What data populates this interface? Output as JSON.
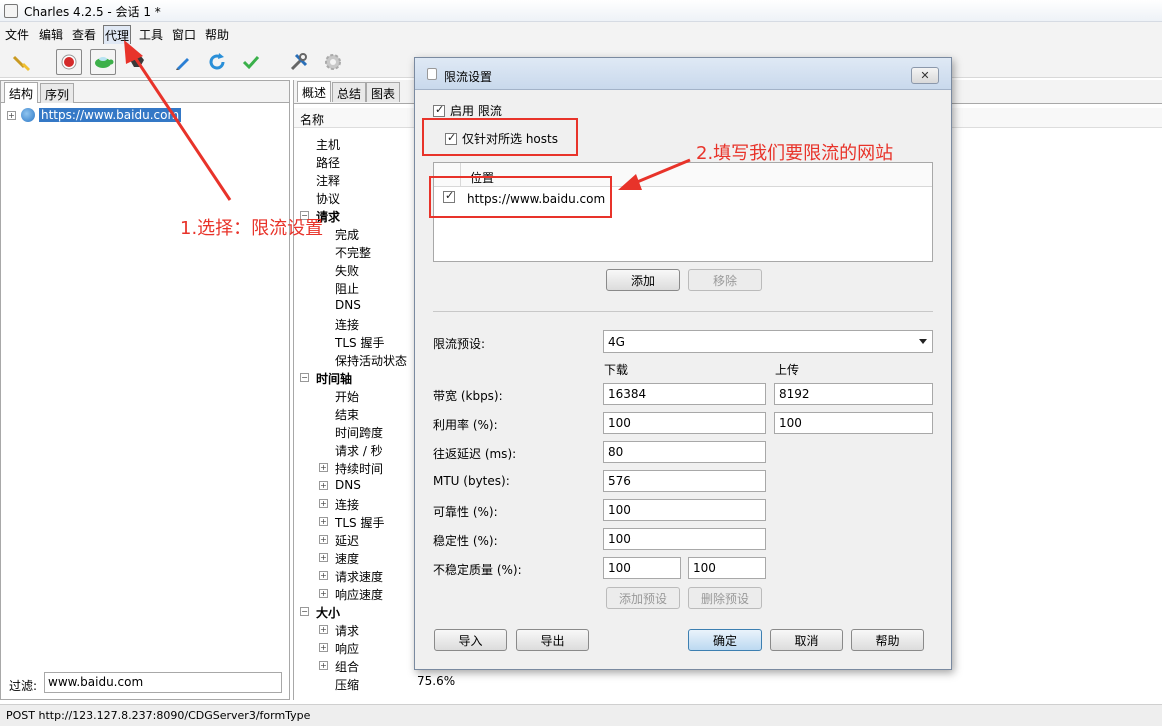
{
  "window": {
    "title": "Charles 4.2.5 - 会话 1 *"
  },
  "menu": [
    "文件",
    "编辑",
    "查看",
    "代理",
    "工具",
    "窗口",
    "帮助"
  ],
  "left": {
    "tabs": [
      "结构",
      "序列"
    ],
    "host": "https://www.baidu.com",
    "filter_label": "过滤:",
    "filter_value": "www.baidu.com"
  },
  "right": {
    "tabs": [
      "概述",
      "总结",
      "图表"
    ],
    "column_name": "名称",
    "props": [
      "主机",
      "路径",
      "注释",
      "协议"
    ],
    "request_section": "请求",
    "request_items": [
      "完成",
      "不完整",
      "失败",
      "阻止",
      "DNS",
      "连接",
      "TLS 握手",
      "保持活动状态"
    ],
    "timeline_section": "时间轴",
    "timeline_items": [
      "开始",
      "结束",
      "时间跨度",
      "请求 / 秒"
    ],
    "timeline_expand_items": [
      "持续时间",
      "DNS",
      "连接",
      "TLS 握手",
      "延迟",
      "速度",
      "请求速度",
      "响应速度"
    ],
    "size_section": "大小",
    "size_expand_items": [
      "请求",
      "响应",
      "组合"
    ],
    "compress_label": "压缩",
    "compress_value": "75.6%"
  },
  "status_bar": "POST http://123.127.8.237:8090/CDGServer3/formType",
  "dialog": {
    "title": "限流设置",
    "enable_label": "启用 限流",
    "only_hosts_label": "仅针对所选 hosts",
    "location_header": "位置",
    "location_row": "https://www.baidu.com",
    "add_button": "添加",
    "remove_button": "移除",
    "preset_label": "限流预设:",
    "preset_value": "4G",
    "download_header": "下载",
    "upload_header": "上传",
    "bandwidth_label": "带宽 (kbps):",
    "bandwidth_down": "16384",
    "bandwidth_up": "8192",
    "utilisation_label": "利用率 (%):",
    "utilisation_down": "100",
    "utilisation_up": "100",
    "latency_label": "往返延迟 (ms):",
    "latency": "80",
    "mtu_label": "MTU (bytes):",
    "mtu": "576",
    "reliability_label": "可靠性 (%):",
    "reliability": "100",
    "stability_label": "稳定性 (%):",
    "stability": "100",
    "unstable_quality_label": "不稳定质量 (%):",
    "unstable_quality_a": "100",
    "unstable_quality_b": "100",
    "add_preset_button": "添加预设",
    "remove_preset_button": "删除预设",
    "import_button": "导入",
    "export_button": "导出",
    "ok_button": "确定",
    "cancel_button": "取消",
    "help_button": "帮助",
    "close_symbol": "✕"
  },
  "annotations": {
    "step1": "1.选择：限流设置",
    "step2": "2.填写我们要限流的网站",
    "color": "#e8332a"
  }
}
